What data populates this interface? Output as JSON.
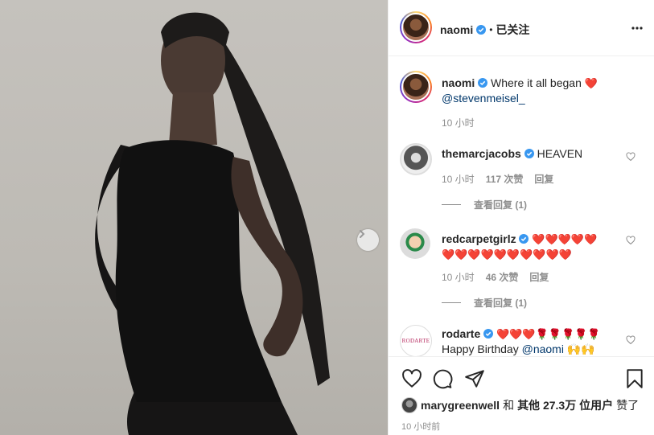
{
  "header": {
    "username": "naomi",
    "dot": "•",
    "follow_status": "已关注",
    "more_icon": "more-horizontal-icon"
  },
  "caption": {
    "username": "naomi",
    "text": "Where it all began",
    "emoji": "❤️",
    "mention": "@stevenmeisel_",
    "time": "10 小时"
  },
  "comments": [
    {
      "username": "themarcjacobs",
      "text": "HEAVEN",
      "time": "10 小时",
      "likes": "117 次赞",
      "reply": "回复",
      "view_replies": "查看回复 (1)"
    },
    {
      "username": "redcarpetgirlz",
      "text_line1": "❤️❤️❤️❤️❤️",
      "text_line2": "❤️❤️❤️❤️❤️❤️❤️❤️❤️❤️",
      "time": "10 小时",
      "likes": "46 次赞",
      "reply": "回复",
      "view_replies": "查看回复 (1)"
    },
    {
      "username": "rodarte",
      "avatar_text": "RODARTE",
      "text_line1": "❤️❤️❤️🌹🌹🌹🌹🌹",
      "text_line2_prefix": "Happy Birthday",
      "mention": "@naomi",
      "text_line2_emoji": "🙌🙌"
    }
  ],
  "liked_by": {
    "user": "marygreenwell",
    "and": "和",
    "others": "其他 27.3万 位用户",
    "liked": "赞了"
  },
  "post_time": "10 小时前",
  "colors": {
    "verified": "#3897f0",
    "heart": "#ed4956",
    "link": "#00376b"
  }
}
